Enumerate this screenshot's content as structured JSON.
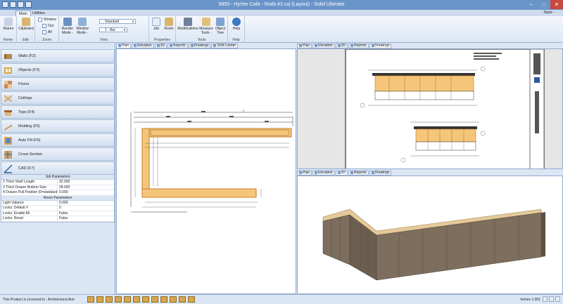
{
  "window": {
    "title": "5850 - HyVee Cafe - Rods #2.cvj (Layout) - Solid Ultimate"
  },
  "tabs": [
    {
      "label": "Main"
    },
    {
      "label": "Utilities"
    }
  ],
  "style_label": "Style -",
  "ribbon": {
    "groups": [
      {
        "label": "Home"
      },
      {
        "label": "Edit"
      },
      {
        "label": "Zoom"
      },
      {
        "label": "View"
      },
      {
        "label": "Properties"
      },
      {
        "label": "Tools"
      },
      {
        "label": "Help"
      }
    ],
    "return_label": "Return",
    "clipboard_label": "Clipboard",
    "zoom_window": "Window",
    "zoom_out": "Out",
    "zoom_all": "All",
    "render_mode": "Render Mode -",
    "window_mode": "Window Mode -",
    "view_select": "Standard",
    "layer_select": "1 - Bar",
    "job_label": "Job",
    "room_label": "Room",
    "modifications_label": "Modifications",
    "measure_label": "Measure Tools -",
    "object_tree_label": "Object Tree",
    "help_label": "Help"
  },
  "tools": [
    {
      "label": "Walls (F2)"
    },
    {
      "label": "Objects (F3)"
    },
    {
      "label": "Floors"
    },
    {
      "label": "Ceilings"
    },
    {
      "label": "Tops (F4)"
    },
    {
      "label": "Molding (F5)"
    },
    {
      "label": "Auto Fill (F6)"
    },
    {
      "label": "Cross Section"
    },
    {
      "label": "CAD (F7)"
    }
  ],
  "job_parameters": {
    "header": "Job Parameters",
    "rows": [
      {
        "key": "2  Thick Shell Length",
        "value": "32.000"
      },
      {
        "key": "3  Thick Drawer Bottom Size",
        "value": "28.000"
      },
      {
        "key": "4  Drawer Pull Position (0=standard)",
        "value": "0.000"
      }
    ]
  },
  "room_parameters": {
    "header": "Room Parameters",
    "rows": [
      {
        "key": "Light Valance",
        "value": "0.000"
      },
      {
        "key": "Locks: Default #",
        "value": "0"
      },
      {
        "key": "Locks: Enable All",
        "value": "False"
      },
      {
        "key": "Locks: Reset",
        "value": "False"
      }
    ]
  },
  "view_tabs_left": [
    {
      "label": "Plan"
    },
    {
      "label": "Elevation"
    },
    {
      "label": "3D"
    },
    {
      "label": "Reports"
    },
    {
      "label": "Drawings"
    },
    {
      "label": "S2M Center"
    }
  ],
  "view_tabs_top_right": [
    {
      "label": "Plan"
    },
    {
      "label": "Elevation"
    },
    {
      "label": "3D"
    },
    {
      "label": "Reports"
    },
    {
      "label": "Drawings"
    }
  ],
  "view_tabs_bottom_right": [
    {
      "label": "Plan"
    },
    {
      "label": "Elevation"
    },
    {
      "label": "3D"
    },
    {
      "label": "Reports"
    },
    {
      "label": "Drawings"
    }
  ],
  "status": {
    "license": "This Product is Licensed to : Architectural Arts",
    "units_label": "Inches",
    "units_value": "1.001"
  },
  "colors": {
    "accent": "#6a95c9",
    "cabinet": "#e8b04a",
    "wall": "#7d6e5e"
  }
}
